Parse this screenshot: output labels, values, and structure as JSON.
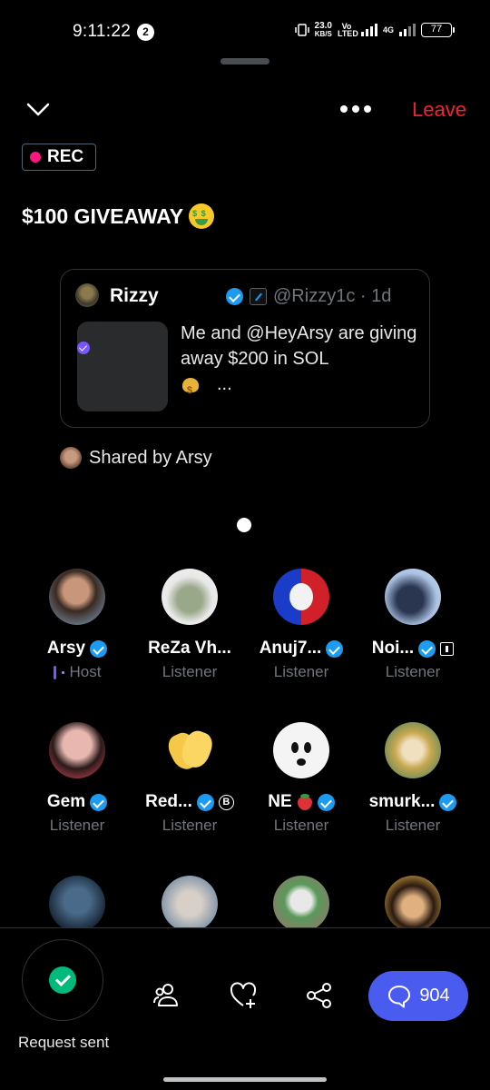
{
  "status_bar": {
    "time": "9:11:22",
    "notification_count": "2",
    "net_speed_value": "23.0",
    "net_speed_unit": "KB/S",
    "volte": "Vo LTED",
    "network": "4G",
    "battery": "77"
  },
  "header": {
    "leave_label": "Leave",
    "rec_label": "REC"
  },
  "space": {
    "title": "$100 GIVEAWAY"
  },
  "tweet": {
    "name": "Rizzy",
    "handle": "@Rizzy1c",
    "age": "· 1d",
    "text_line": "Me and @HeyArsy  are giving away $200 in SOL",
    "ellipsis": "..."
  },
  "shared_by": "Shared by Arsy",
  "participants": [
    {
      "name": "Arsy",
      "role": "Host",
      "verified": true
    },
    {
      "name": "ReZa Vh...",
      "role": "Listener",
      "verified": false
    },
    {
      "name": "Anuj7...",
      "role": "Listener",
      "verified": true
    },
    {
      "name": "Noi...",
      "role": "Listener",
      "verified": true
    },
    {
      "name": "Gem",
      "role": "Listener",
      "verified": true
    },
    {
      "name": "Red...",
      "role": "Listener",
      "verified": true
    },
    {
      "name": "NE",
      "role": "Listener",
      "verified": true
    },
    {
      "name": "smurk...",
      "role": "Listener",
      "verified": true
    }
  ],
  "bottom_bar": {
    "request_label": "Request sent",
    "comment_count": "904"
  },
  "colors": {
    "accent_red": "#f4212e",
    "verified_blue": "#1d9bf0",
    "comment_button": "#4a5cf0",
    "request_check": "#00ba7c",
    "host_purple": "#7856ff"
  }
}
